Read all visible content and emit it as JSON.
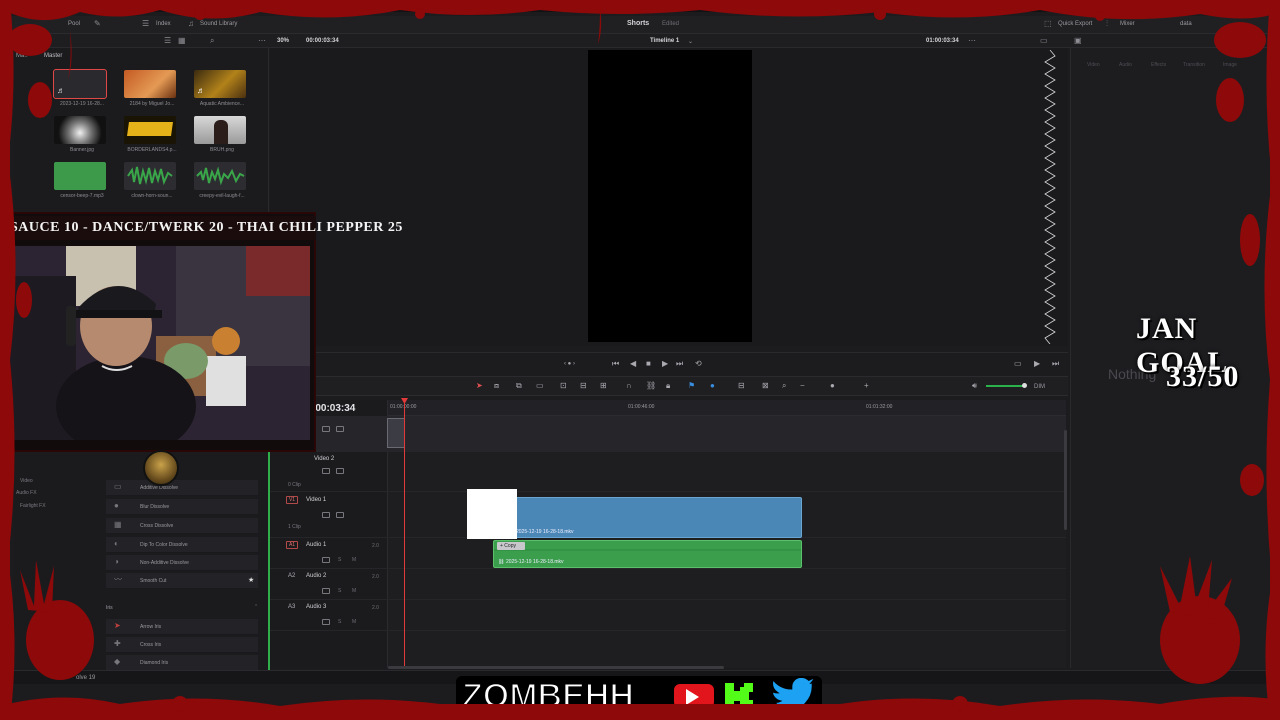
{
  "toolbar": {
    "pool_label": "Pool",
    "index_label": "Index",
    "sound_library_label": "Sound Library",
    "project_name": "Shorts",
    "project_status": "Edited",
    "quick_export_label": "Quick Export",
    "mixer_label": "Mixer",
    "meta_label": "data"
  },
  "subbar": {
    "zoom": "30%",
    "source_timecode": "00:00:03:34",
    "timeline_name": "Timeline 1",
    "record_timecode": "01:00:03:34"
  },
  "media_pool": {
    "tab_left": "Ma..",
    "tab_master": "Master",
    "items": [
      {
        "name": "2023-12-19 16-28...",
        "kind": "audio"
      },
      {
        "name": "2184 by Miguel Jo...",
        "kind": "video"
      },
      {
        "name": "Aquatic Ambience...",
        "kind": "audio"
      },
      {
        "name": "Banner.jpg",
        "kind": "image"
      },
      {
        "name": "BORDERLANDS4.p...",
        "kind": "image"
      },
      {
        "name": "BRUH.png",
        "kind": "image"
      },
      {
        "name": "censor-beep-7.mp3",
        "kind": "audio"
      },
      {
        "name": "clown-horn-soun...",
        "kind": "audio"
      },
      {
        "name": "creepy-evil-laugh-f...",
        "kind": "audio"
      }
    ]
  },
  "inspector": {
    "tabs": [
      "Video",
      "Audio",
      "Effects",
      "Transition",
      "Image"
    ],
    "empty_text": "Nothing"
  },
  "timeline": {
    "timecode": ":00:03:34",
    "ruler": [
      "01:00:00:00",
      "01:00:46:00",
      "01:01:32:00"
    ],
    "dim_label": "DIM",
    "tracks": [
      {
        "badge": "",
        "name": "Video 2",
        "clips": "0 Clip",
        "vol": ""
      },
      {
        "badge": "V1",
        "name": "Video 1",
        "clips": "1 Clip",
        "vol": ""
      },
      {
        "badge": "A1",
        "name": "Audio 1",
        "clips": "",
        "vol": "2.0"
      },
      {
        "badge": "A2",
        "name": "Audio 2",
        "clips": "",
        "vol": "2.0"
      },
      {
        "badge": "A3",
        "name": "Audio 3",
        "clips": "",
        "vol": "2.0"
      }
    ],
    "video_clip_name": "2025-12-19 16-28-18.mkv",
    "audio_clip_name": "2025-12-19 16-28-18.mkv",
    "copy_tag": "+ Copy",
    "playhead_tc_label": "01:00:00:00"
  },
  "effects": {
    "side_items": [
      "Video",
      "Audio FX",
      "Fairlight FX"
    ],
    "rows": [
      "Additive Dissolve",
      "Blur Dissolve",
      "Cross Dissolve",
      "Dip To Color Dissolve",
      "Non-Additive Dissolve",
      "Smooth Cut"
    ],
    "iris_header": "Iris",
    "iris_rows": [
      "Arrow Iris",
      "Cross Iris",
      "Diamond Iris"
    ]
  },
  "status": {
    "app_label": "olve 19"
  },
  "overlay": {
    "marquee": "SAUCE 10 - DANCE/TWERK 20 - THAI CHILI PEPPER 25",
    "goal_title": "JAN GOAL",
    "goal_count": "33/50",
    "logo_text": "ZOMBEHH",
    "cap_text": "ZOMBEHH"
  },
  "colors": {
    "video_clip": "#4a87b6",
    "audio_clip": "#3a9e4c",
    "playhead": "#e03a3a",
    "blood": "#9b0a0a"
  }
}
